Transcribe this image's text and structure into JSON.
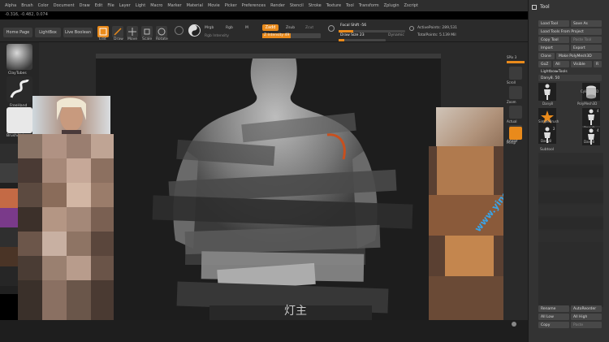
{
  "menu": [
    "Alpha",
    "Brush",
    "Color",
    "Document",
    "Draw",
    "Edit",
    "File",
    "Layer",
    "Light",
    "Macro",
    "Marker",
    "Material",
    "Movie",
    "Picker",
    "Preferences",
    "Render",
    "Stencil",
    "Stroke",
    "Texture",
    "Tool",
    "Transform",
    "Zplugin",
    "Zscript"
  ],
  "coords": "-0.316, -0.482, 0.074",
  "shelf": {
    "home_page": "Home Page",
    "lightbox": "LightBox",
    "live_boolean": "Live Boolean",
    "edit": "Edit",
    "draw": "Draw",
    "move": "Move",
    "scale": "Scale",
    "rotate": "Rotate",
    "mrgb": "Mrgb",
    "rgb": "Rgb",
    "m": "M",
    "rgb_intensity": "Rgb Intensity",
    "zadd": "Zadd",
    "zsub": "Zsub",
    "zcut": "Zcut",
    "z_intensity_label": "Z Intensity",
    "z_intensity_value": 49,
    "focal_shift_label": "Focal Shift",
    "focal_shift_value": -56,
    "draw_size_label": "Draw Size",
    "draw_size_value": 23,
    "dynamic": "Dynamic",
    "active_points": "ActivePoints: 289,531",
    "total_points": "TotalPoints: 5.139 Mil"
  },
  "left_tray": {
    "brush1": "ClayTubes",
    "brush2": "FreeHand",
    "brush3": "BrushAlpha"
  },
  "right_dock": {
    "spix_label": "SPix",
    "spix_value": 3,
    "items": [
      "Scroll",
      "Zoom",
      "Actual",
      "AAHalf",
      "Persp"
    ]
  },
  "palette": {
    "title": "Tool",
    "load_tool": "Load Tool",
    "save_as": "Save As",
    "load_from_project": "Load Tools From Project",
    "copy_tool": "Copy Tool",
    "paste_tool": "Paste Tool",
    "import": "Import",
    "export": "Export",
    "clone": "Clone",
    "make_polymesh": "Make PolyMesh3D",
    "goz": "GoZ",
    "all": "All",
    "visible": "Visible",
    "r": "R",
    "lightbox_tools": "Lightbox▸Tools",
    "current_tool": "Dany8. 50",
    "tools": [
      {
        "name": "Dany8",
        "count": ""
      },
      {
        "name": "PolyMesh3D",
        "count": ""
      },
      {
        "name": "Cylinder3D",
        "count": ""
      },
      {
        "name": "SimpleBrush",
        "count": ""
      },
      {
        "name": "Dany8",
        "count": "4"
      },
      {
        "name": "Dany8",
        "count": "2"
      },
      {
        "name": "Dany8",
        "count": "4"
      }
    ],
    "subtool": "Subtool",
    "bottom": {
      "rename": "Rename",
      "autoreorder": "AutoReorder",
      "all_low": "All Low",
      "all_high": "All High",
      "copy": "Copy",
      "paste": "Paste"
    }
  },
  "canvas": {
    "watermark": "灯主",
    "url_watermark": "www.yingyaoshi.com"
  },
  "colors": {
    "accent": "#e98a1b",
    "menu_bg": "#2e2e2e",
    "canvas_bg": "#1d1d1d",
    "watermark_blue": "#3aa3e6"
  }
}
